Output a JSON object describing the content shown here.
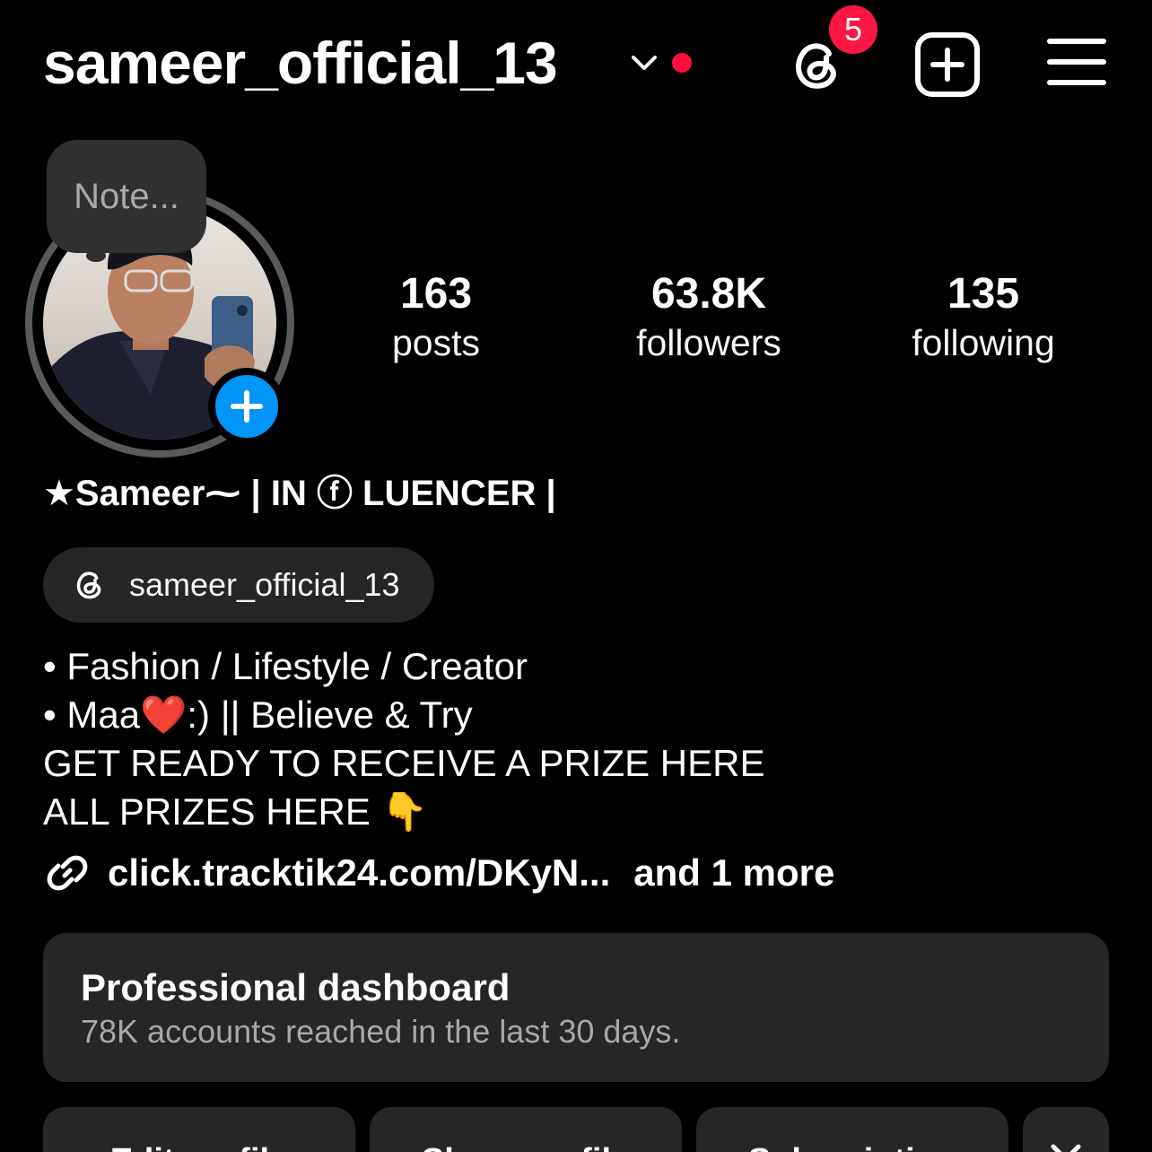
{
  "header": {
    "username": "sameer_official_13",
    "threads_badge": "5"
  },
  "profile": {
    "note_placeholder": "Note...",
    "stats": [
      {
        "value": "163",
        "label": "posts"
      },
      {
        "value": "63.8K",
        "label": "followers"
      },
      {
        "value": "135",
        "label": "following"
      }
    ],
    "full_name": "★Sameer⁓ | IN ⓕ LUENCER  |",
    "threads_handle": "sameer_official_13",
    "bio_lines": [
      "• Fashion / Lifestyle / Creator",
      "• Maa❤️:) || Believe & Try",
      "GET READY TO RECEIVE A PRIZE HERE",
      "ALL PRIZES HERE 👇"
    ],
    "link": "click.tracktik24.com/DKyN...",
    "link_more": "and 1 more"
  },
  "dashboard": {
    "title": "Professional dashboard",
    "subtitle": "78K accounts reached in the last 30 days."
  },
  "buttons": {
    "edit": "Edit profile",
    "share": "Share profile",
    "subscription": "Subscription"
  },
  "colors": {
    "background": "#000000",
    "surface": "#262626",
    "accent_blue": "#0095f6",
    "notification_red": "#ff1744"
  }
}
